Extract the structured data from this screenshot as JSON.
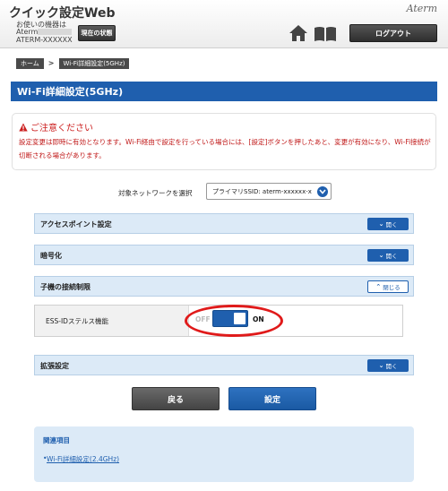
{
  "header": {
    "app_title": "クイック設定Web",
    "device_label": "お使いの機器は",
    "device_name": "Aterm",
    "device_id": "ATERM-XXXXXX",
    "status_button": "現在の状態",
    "brand_logo": "Aterm",
    "logout_button": "ログアウト",
    "icons": [
      "home-icon",
      "manual-book-icon"
    ]
  },
  "breadcrumb": {
    "home": "ホーム",
    "separator": ">",
    "current": "Wi-Fi詳細設定(5GHz)"
  },
  "page": {
    "title": "Wi-Fi詳細設定(5GHz)"
  },
  "notice": {
    "heading": "ご注意ください",
    "body": "設定変更は即時に有効となります。Wi-Fi経由で設定を行っている場合には、[設定]ボタンを押したあと、変更が有効になり、Wi-Fi接続が切断される場合があります。",
    "color": "#cc1f1f"
  },
  "network_select": {
    "label": "対象ネットワークを選択",
    "value": "プライマリSSID: aterm-xxxxxx-x"
  },
  "sections": [
    {
      "label": "アクセスポイント設定",
      "toggle": "開く",
      "state": "collapsed"
    },
    {
      "label": "暗号化",
      "toggle": "開く",
      "state": "collapsed"
    },
    {
      "label": "子機の接続制限",
      "toggle": "閉じる",
      "state": "expanded"
    },
    {
      "label": "拡張設定",
      "toggle": "開く",
      "state": "collapsed"
    }
  ],
  "stealth": {
    "label": "ESS-IDステルス機能",
    "off_label": "OFF",
    "on_label": "ON",
    "value": "ON"
  },
  "actions": {
    "back": "戻る",
    "save": "設定"
  },
  "related": {
    "title": "関連項目",
    "links": [
      "Wi-Fi詳細設定(2.4GHz)"
    ]
  },
  "colors": {
    "accent": "#1f5fae",
    "section_bg": "#dceaf7",
    "highlight": "#e01a1a"
  }
}
